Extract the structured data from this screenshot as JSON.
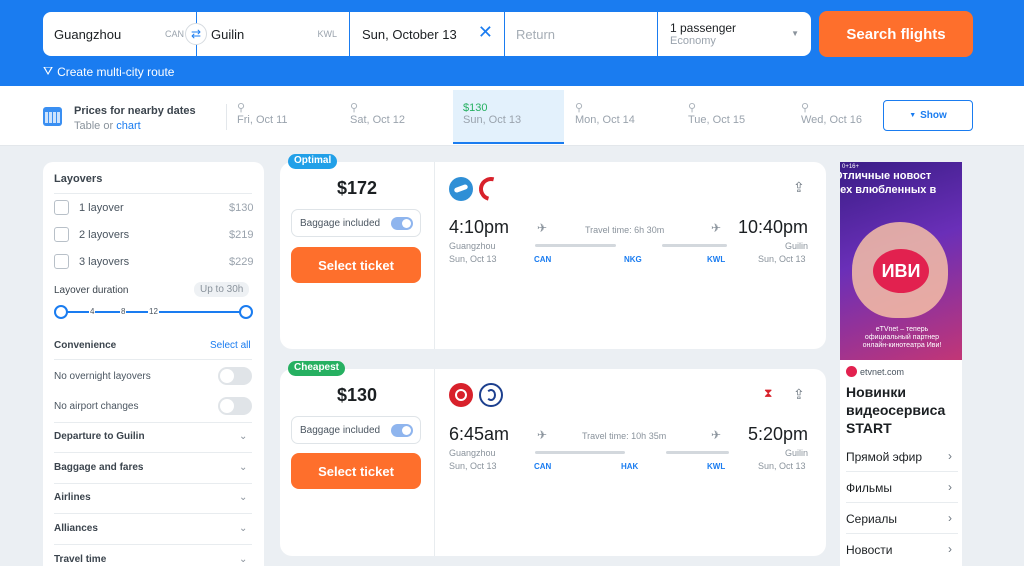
{
  "search": {
    "from_city": "Guangzhou",
    "from_code": "CAN",
    "to_city": "Guilin",
    "to_code": "KWL",
    "depart": "Sun, October 13",
    "return_placeholder": "Return",
    "passengers": "1 passenger",
    "cabin": "Economy",
    "search_label": "Search flights",
    "multi_city": "Create multi-city route"
  },
  "dates": {
    "nearby_title": "Prices for nearby dates",
    "view_table": "Table",
    "view_or": "or",
    "view_chart": "chart",
    "items": [
      {
        "price": "",
        "label": "Fri, Oct 11"
      },
      {
        "price": "",
        "label": "Sat, Oct 12"
      },
      {
        "price": "$130",
        "label": "Sun, Oct 13"
      },
      {
        "price": "",
        "label": "Mon, Oct 14"
      },
      {
        "price": "",
        "label": "Tue, Oct 15"
      },
      {
        "price": "",
        "label": "Wed, Oct 16"
      }
    ],
    "show_label": "Show"
  },
  "filters": {
    "layovers_title": "Layovers",
    "layovers": [
      {
        "label": "1 layover",
        "price": "$130"
      },
      {
        "label": "2 layovers",
        "price": "$219"
      },
      {
        "label": "3 layovers",
        "price": "$229"
      }
    ],
    "duration_title": "Layover duration",
    "duration_value": "Up to 30h",
    "ticks": [
      "4",
      "8",
      "12"
    ],
    "convenience_title": "Convenience",
    "select_all": "Select all",
    "no_overnight": "No overnight layovers",
    "no_airport_change": "No airport changes",
    "sections": [
      "Departure to Guilin",
      "Baggage and fares",
      "Airlines",
      "Alliances",
      "Travel time"
    ]
  },
  "results": [
    {
      "badge": "Optimal",
      "badge_color": "#22a0e8",
      "price": "$172",
      "baggage": "Baggage included",
      "select": "Select ticket",
      "dep_time": "4:10pm",
      "dep_city": "Guangzhou",
      "dep_date": "Sun, Oct 13",
      "arr_time": "10:40pm",
      "arr_city": "Guilin",
      "arr_date": "Sun, Oct 13",
      "travel_time": "Travel time: 6h 30m",
      "stops": [
        "CAN",
        "NKG",
        "KWL"
      ]
    },
    {
      "badge": "Cheapest",
      "badge_color": "#26b061",
      "price": "$130",
      "baggage": "Baggage included",
      "select": "Select ticket",
      "dep_time": "6:45am",
      "dep_city": "Guangzhou",
      "dep_date": "Sun, Oct 13",
      "arr_time": "5:20pm",
      "arr_city": "Guilin",
      "arr_date": "Sun, Oct 13",
      "travel_time": "Travel time: 10h 35m",
      "stops": [
        "CAN",
        "HAK",
        "KWL"
      ]
    }
  ],
  "ad": {
    "age": "0+16+",
    "headline_1": "Отличные новост",
    "headline_2": "сех влюбленных в",
    "logo": "иви",
    "caption": "eTVnet – теперь официальный партнер онлайн-кинотеатра Иви!",
    "domain": "etvnet.com",
    "title": "Новинки видеосервиса START",
    "menu": [
      "Прямой эфир",
      "Фильмы",
      "Сериалы",
      "Новости"
    ]
  },
  "colors": {
    "accent": "#1a7cf0",
    "orange": "#fe6f2c"
  }
}
